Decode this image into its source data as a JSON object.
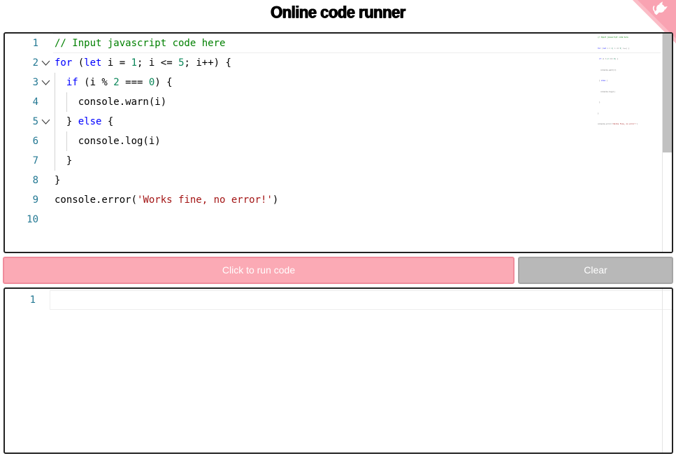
{
  "page": {
    "title": "Online code runner"
  },
  "colors": {
    "run_button_bg": "#fbaab5",
    "clear_button_bg": "#b8b8b8",
    "corner_badge": "#f9a3b2",
    "line_number": "#237893",
    "keyword": "#0000ff",
    "comment": "#008000",
    "number": "#098658",
    "string": "#a31515"
  },
  "editor": {
    "lines": [
      {
        "number": "1",
        "fold": false,
        "indent": 0,
        "tokens": [
          {
            "t": "// Input javascript code here",
            "c": "comment"
          }
        ]
      },
      {
        "number": "2",
        "fold": true,
        "indent": 0,
        "tokens": [
          {
            "t": "for",
            "c": "kw"
          },
          {
            "t": " (",
            "c": ""
          },
          {
            "t": "let",
            "c": "kw"
          },
          {
            "t": " i = ",
            "c": ""
          },
          {
            "t": "1",
            "c": "num"
          },
          {
            "t": "; i <= ",
            "c": ""
          },
          {
            "t": "5",
            "c": "num"
          },
          {
            "t": "; i++) {",
            "c": ""
          }
        ]
      },
      {
        "number": "3",
        "fold": true,
        "indent": 1,
        "tokens": [
          {
            "t": "if",
            "c": "kw"
          },
          {
            "t": " (i % ",
            "c": ""
          },
          {
            "t": "2",
            "c": "num"
          },
          {
            "t": " === ",
            "c": ""
          },
          {
            "t": "0",
            "c": "num"
          },
          {
            "t": ") {",
            "c": ""
          }
        ]
      },
      {
        "number": "4",
        "fold": false,
        "indent": 2,
        "tokens": [
          {
            "t": "console.warn(i)",
            "c": ""
          }
        ]
      },
      {
        "number": "5",
        "fold": true,
        "indent": 1,
        "tokens": [
          {
            "t": "} ",
            "c": ""
          },
          {
            "t": "else",
            "c": "kw"
          },
          {
            "t": " {",
            "c": ""
          }
        ]
      },
      {
        "number": "6",
        "fold": false,
        "indent": 2,
        "tokens": [
          {
            "t": "console.log(i)",
            "c": ""
          }
        ]
      },
      {
        "number": "7",
        "fold": false,
        "indent": 1,
        "tokens": [
          {
            "t": "}",
            "c": ""
          }
        ]
      },
      {
        "number": "8",
        "fold": false,
        "indent": 0,
        "tokens": [
          {
            "t": "}",
            "c": ""
          }
        ]
      },
      {
        "number": "9",
        "fold": false,
        "indent": 0,
        "tokens": [
          {
            "t": "console.error(",
            "c": ""
          },
          {
            "t": "'Works fine, no error!'",
            "c": "str"
          },
          {
            "t": ")",
            "c": ""
          }
        ]
      },
      {
        "number": "10",
        "fold": false,
        "indent": 0,
        "tokens": []
      }
    ]
  },
  "buttons": {
    "run_label": "Click to run code",
    "clear_label": "Clear"
  },
  "output": {
    "lines": [
      {
        "number": "1",
        "text": ""
      }
    ]
  },
  "icons": {
    "fold": "chevron-down-icon",
    "corner": "github-octocat-icon"
  }
}
